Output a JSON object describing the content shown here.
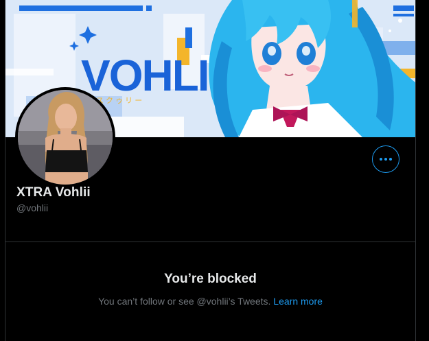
{
  "banner": {
    "logo_text": "VOHLII",
    "image_description_icon": "anime-character-banner"
  },
  "avatar": {
    "icon": "profile-photo"
  },
  "profile": {
    "display_name": "XTRA Vohlii",
    "handle": "@vohlii"
  },
  "actions": {
    "more_icon": "more-horizontal-icon"
  },
  "blocked": {
    "title": "You’re blocked",
    "message_prefix": "You can’t follow or see @vohlii’s Tweets. ",
    "learn_more": "Learn more"
  },
  "colors": {
    "background": "#000000",
    "accent": "#1d9bf0",
    "primary_text": "#e7e9ea",
    "secondary_text": "#71767b",
    "border": "#2f3336"
  }
}
